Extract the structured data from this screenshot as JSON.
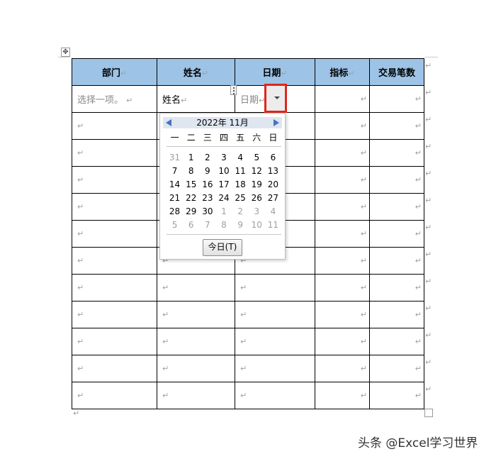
{
  "table": {
    "headers": [
      "部门",
      "姓名",
      "日期",
      "指标",
      "交易笔数"
    ],
    "first_row": {
      "department_placeholder": "选择一项。",
      "name": "姓名",
      "date_placeholder": "日期"
    },
    "empty_rows": 11,
    "paragraph_mark": "↵"
  },
  "calendar": {
    "month_title": "2022年 11月",
    "weekdays": [
      "一",
      "二",
      "三",
      "四",
      "五",
      "六",
      "日"
    ],
    "weeks": [
      [
        "31",
        "1",
        "2",
        "3",
        "4",
        "5",
        "6"
      ],
      [
        "7",
        "8",
        "9",
        "10",
        "11",
        "12",
        "13"
      ],
      [
        "14",
        "15",
        "16",
        "17",
        "18",
        "19",
        "20"
      ],
      [
        "21",
        "22",
        "23",
        "24",
        "25",
        "26",
        "27"
      ],
      [
        "28",
        "29",
        "30",
        "1",
        "2",
        "3",
        "4"
      ],
      [
        "5",
        "6",
        "7",
        "8",
        "9",
        "10",
        "11"
      ]
    ],
    "today_button": "今日(T)"
  },
  "watermark": "头条 @Excel学习世界"
}
